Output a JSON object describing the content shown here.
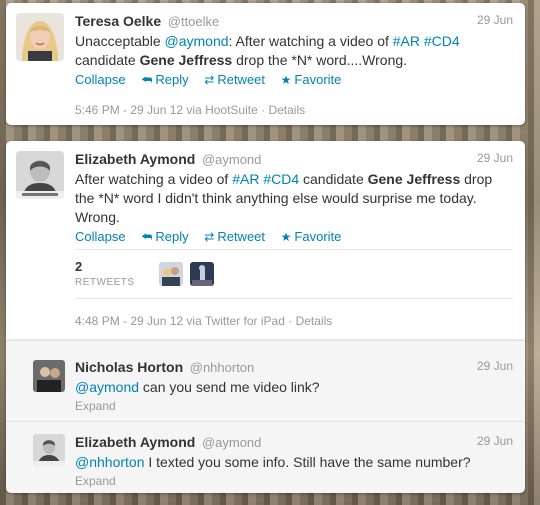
{
  "tweets": [
    {
      "fullname": "Teresa Oelke",
      "username": "@ttoelke",
      "time": "29 Jun",
      "text_parts": {
        "p1": "Unacceptable ",
        "mention": "@aymond",
        "p2": ": After watching a video of ",
        "tag1": "#AR",
        "tag2": "#CD4",
        "p3": "candidate ",
        "bold": "Gene Jeffress",
        "p4": " drop the *N* word....Wrong."
      },
      "actions": {
        "collapse": "Collapse",
        "reply": "Reply",
        "retweet": "Retweet",
        "favorite": "Favorite"
      },
      "meta": {
        "timestamp": "5:46 PM - 29 Jun 12 via HootSuite",
        "separator": " · ",
        "details": "Details"
      }
    },
    {
      "fullname": "Elizabeth Aymond",
      "username": "@aymond",
      "time": "29 Jun",
      "text_parts": {
        "p1": "After watching a video of ",
        "tag1": "#AR",
        "tag2": "#CD4",
        "p2": " candidate ",
        "bold": "Gene Jeffress",
        "p3": " drop the *N* word I didn't think anything else would surprise me today. Wrong."
      },
      "actions": {
        "collapse": "Collapse",
        "reply": "Reply",
        "retweet": "Retweet",
        "favorite": "Favorite"
      },
      "stats": {
        "count": "2",
        "label": "RETWEETS"
      },
      "meta": {
        "timestamp": "4:48 PM - 29 Jun 12 via Twitter for iPad",
        "separator": " · ",
        "details": "Details"
      }
    }
  ],
  "replies": [
    {
      "fullname": "Nicholas Horton",
      "username": "@nhhorton",
      "time": "29 Jun",
      "mention": "@aymond",
      "text": " can you send me video link?",
      "expand": "Expand"
    },
    {
      "fullname": "Elizabeth Aymond",
      "username": "@aymond",
      "time": "29 Jun",
      "mention": "@nhhorton",
      "text": " I texted you some info. Still have the same number?",
      "expand": "Expand"
    }
  ],
  "icons": {
    "reply": "reply-arrow-icon",
    "retweet": "retweet-icon",
    "favorite": "star-icon"
  },
  "colors": {
    "link": "#0084b4",
    "muted": "#999999",
    "text": "#333333"
  }
}
